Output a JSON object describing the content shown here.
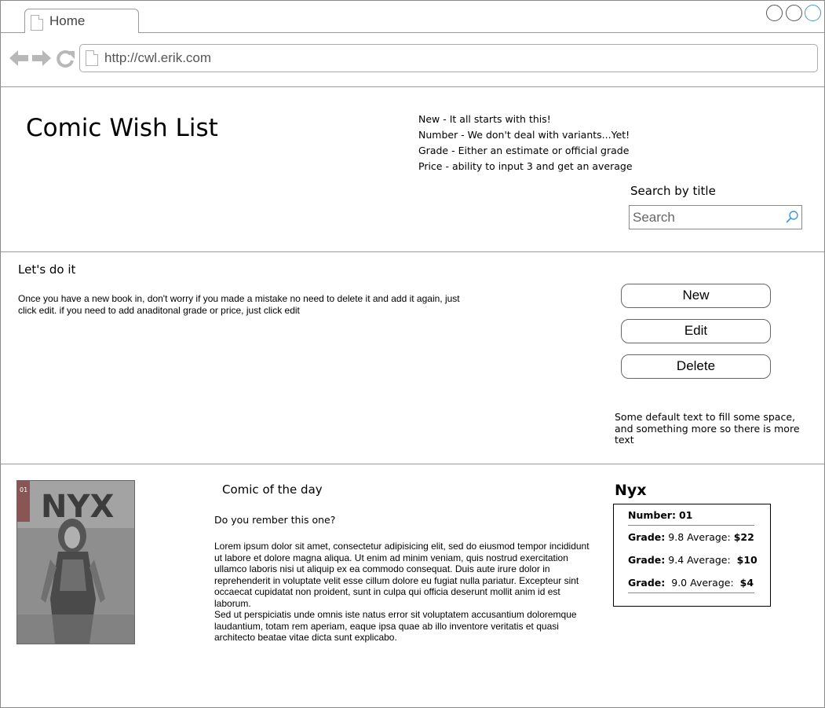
{
  "browser": {
    "tab_label": "Home",
    "url": "http://cwl.erik.com"
  },
  "header": {
    "title": "Comic Wish List",
    "notes": [
      "New - It all starts with this!",
      "Number - We don't deal with variants...Yet!",
      "Grade - Either an estimate or official grade",
      "Price - ability to input 3 and get an average"
    ],
    "search_label": "Search by title",
    "search_placeholder": "Search"
  },
  "actions": {
    "title": "Let's do it",
    "description": "Once you have a new book in, don't worry if you made a mistake no need to delete it and add it again, just click edit.  if you need to add anaditonal grade or price, just click edit",
    "new_label": "New",
    "edit_label": "Edit",
    "delete_label": "Delete",
    "filler_text": "Some default text to fill some space, and something more so there is more text"
  },
  "comic_of_day": {
    "heading": "Comic of the day",
    "question": "Do you rember this one?",
    "lorem_1": "Lorem ipsum dolor sit amet, consectetur adipisicing elit, sed do eiusmod tempor incididunt ut labore et dolore magna aliqua. Ut enim ad minim veniam, quis nostrud exercitation ullamco laboris nisi ut aliquip ex ea commodo consequat. Duis aute irure dolor in reprehenderit in voluptate velit esse cillum dolore eu fugiat nulla pariatur. Excepteur sint occaecat cupidatat non proident, sunt in culpa qui officia deserunt mollit anim id est laborum.",
    "lorem_2": "Sed ut perspiciatis unde omnis iste natus error sit voluptatem accusantium doloremque laudantium, totam rem aperiam, eaque ipsa quae ab illo inventore veritatis et quasi architecto beatae vitae dicta sunt explicabo.",
    "cover": {
      "logo": "NYX",
      "issue": "01"
    }
  },
  "comic_card": {
    "name": "Nyx",
    "number_label": "Number:",
    "number": "01",
    "grades": [
      {
        "grade_label": "Grade:",
        "grade": "9.8",
        "avg_label": "Average:",
        "price": "$22"
      },
      {
        "grade_label": "Grade:",
        "grade": "9.4",
        "avg_label": "Average:",
        "price": "$10"
      },
      {
        "grade_label": "Grade:",
        "grade": "9.0",
        "avg_label": "Average:",
        "price": "$4"
      }
    ]
  },
  "colors": {
    "border": "#9a9a9a",
    "window_button_active": "#3a9ad9"
  }
}
